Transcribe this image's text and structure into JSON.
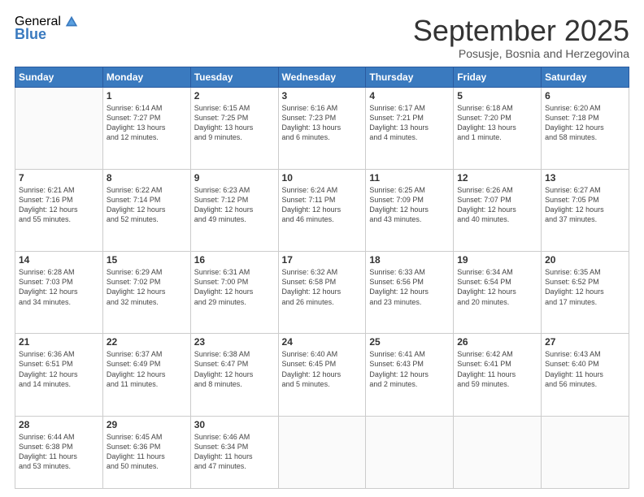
{
  "logo": {
    "general": "General",
    "blue": "Blue"
  },
  "header": {
    "month": "September 2025",
    "location": "Posusje, Bosnia and Herzegovina"
  },
  "days_of_week": [
    "Sunday",
    "Monday",
    "Tuesday",
    "Wednesday",
    "Thursday",
    "Friday",
    "Saturday"
  ],
  "weeks": [
    [
      {
        "day": "",
        "info": ""
      },
      {
        "day": "1",
        "info": "Sunrise: 6:14 AM\nSunset: 7:27 PM\nDaylight: 13 hours\nand 12 minutes."
      },
      {
        "day": "2",
        "info": "Sunrise: 6:15 AM\nSunset: 7:25 PM\nDaylight: 13 hours\nand 9 minutes."
      },
      {
        "day": "3",
        "info": "Sunrise: 6:16 AM\nSunset: 7:23 PM\nDaylight: 13 hours\nand 6 minutes."
      },
      {
        "day": "4",
        "info": "Sunrise: 6:17 AM\nSunset: 7:21 PM\nDaylight: 13 hours\nand 4 minutes."
      },
      {
        "day": "5",
        "info": "Sunrise: 6:18 AM\nSunset: 7:20 PM\nDaylight: 13 hours\nand 1 minute."
      },
      {
        "day": "6",
        "info": "Sunrise: 6:20 AM\nSunset: 7:18 PM\nDaylight: 12 hours\nand 58 minutes."
      }
    ],
    [
      {
        "day": "7",
        "info": "Sunrise: 6:21 AM\nSunset: 7:16 PM\nDaylight: 12 hours\nand 55 minutes."
      },
      {
        "day": "8",
        "info": "Sunrise: 6:22 AM\nSunset: 7:14 PM\nDaylight: 12 hours\nand 52 minutes."
      },
      {
        "day": "9",
        "info": "Sunrise: 6:23 AM\nSunset: 7:12 PM\nDaylight: 12 hours\nand 49 minutes."
      },
      {
        "day": "10",
        "info": "Sunrise: 6:24 AM\nSunset: 7:11 PM\nDaylight: 12 hours\nand 46 minutes."
      },
      {
        "day": "11",
        "info": "Sunrise: 6:25 AM\nSunset: 7:09 PM\nDaylight: 12 hours\nand 43 minutes."
      },
      {
        "day": "12",
        "info": "Sunrise: 6:26 AM\nSunset: 7:07 PM\nDaylight: 12 hours\nand 40 minutes."
      },
      {
        "day": "13",
        "info": "Sunrise: 6:27 AM\nSunset: 7:05 PM\nDaylight: 12 hours\nand 37 minutes."
      }
    ],
    [
      {
        "day": "14",
        "info": "Sunrise: 6:28 AM\nSunset: 7:03 PM\nDaylight: 12 hours\nand 34 minutes."
      },
      {
        "day": "15",
        "info": "Sunrise: 6:29 AM\nSunset: 7:02 PM\nDaylight: 12 hours\nand 32 minutes."
      },
      {
        "day": "16",
        "info": "Sunrise: 6:31 AM\nSunset: 7:00 PM\nDaylight: 12 hours\nand 29 minutes."
      },
      {
        "day": "17",
        "info": "Sunrise: 6:32 AM\nSunset: 6:58 PM\nDaylight: 12 hours\nand 26 minutes."
      },
      {
        "day": "18",
        "info": "Sunrise: 6:33 AM\nSunset: 6:56 PM\nDaylight: 12 hours\nand 23 minutes."
      },
      {
        "day": "19",
        "info": "Sunrise: 6:34 AM\nSunset: 6:54 PM\nDaylight: 12 hours\nand 20 minutes."
      },
      {
        "day": "20",
        "info": "Sunrise: 6:35 AM\nSunset: 6:52 PM\nDaylight: 12 hours\nand 17 minutes."
      }
    ],
    [
      {
        "day": "21",
        "info": "Sunrise: 6:36 AM\nSunset: 6:51 PM\nDaylight: 12 hours\nand 14 minutes."
      },
      {
        "day": "22",
        "info": "Sunrise: 6:37 AM\nSunset: 6:49 PM\nDaylight: 12 hours\nand 11 minutes."
      },
      {
        "day": "23",
        "info": "Sunrise: 6:38 AM\nSunset: 6:47 PM\nDaylight: 12 hours\nand 8 minutes."
      },
      {
        "day": "24",
        "info": "Sunrise: 6:40 AM\nSunset: 6:45 PM\nDaylight: 12 hours\nand 5 minutes."
      },
      {
        "day": "25",
        "info": "Sunrise: 6:41 AM\nSunset: 6:43 PM\nDaylight: 12 hours\nand 2 minutes."
      },
      {
        "day": "26",
        "info": "Sunrise: 6:42 AM\nSunset: 6:41 PM\nDaylight: 11 hours\nand 59 minutes."
      },
      {
        "day": "27",
        "info": "Sunrise: 6:43 AM\nSunset: 6:40 PM\nDaylight: 11 hours\nand 56 minutes."
      }
    ],
    [
      {
        "day": "28",
        "info": "Sunrise: 6:44 AM\nSunset: 6:38 PM\nDaylight: 11 hours\nand 53 minutes."
      },
      {
        "day": "29",
        "info": "Sunrise: 6:45 AM\nSunset: 6:36 PM\nDaylight: 11 hours\nand 50 minutes."
      },
      {
        "day": "30",
        "info": "Sunrise: 6:46 AM\nSunset: 6:34 PM\nDaylight: 11 hours\nand 47 minutes."
      },
      {
        "day": "",
        "info": ""
      },
      {
        "day": "",
        "info": ""
      },
      {
        "day": "",
        "info": ""
      },
      {
        "day": "",
        "info": ""
      }
    ]
  ]
}
